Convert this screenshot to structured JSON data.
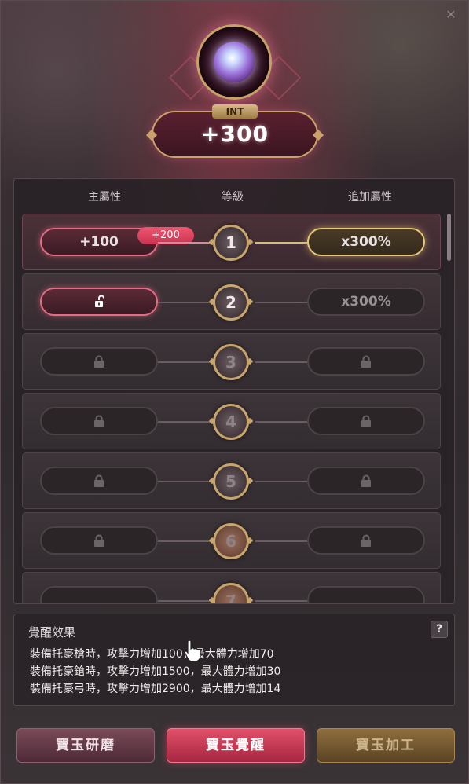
{
  "header": {
    "stat_tag": "INT",
    "stat_value": "+300"
  },
  "table": {
    "columns": [
      "主屬性",
      "等級",
      "追加屬性"
    ],
    "rows": [
      {
        "level": "1",
        "main": "+100",
        "bonus": "+200",
        "extra": "x300%",
        "state": "active"
      },
      {
        "level": "2",
        "main": "",
        "extra": "x300%",
        "state": "unlocked"
      },
      {
        "level": "3",
        "state": "locked"
      },
      {
        "level": "4",
        "state": "locked"
      },
      {
        "level": "5",
        "state": "locked"
      },
      {
        "level": "6",
        "state": "locked"
      },
      {
        "level": "7",
        "state": "locked"
      }
    ]
  },
  "effect": {
    "title": "覺醒效果",
    "help": "?",
    "lines": [
      "裝備托豪槍時，攻擊力增加100，最大體力增加70",
      "裝備托豪鎗時，攻擊力增加1500，最大體力增加30",
      "裝備托豪弓時，攻擊力增加2900，最大體力增加14"
    ]
  },
  "buttons": {
    "polish": "寶玉研磨",
    "awaken": "寶玉覺醒",
    "process": "寶玉加工"
  },
  "colors": {
    "accent_pink": "#e46d86",
    "accent_gold": "#e7c77a",
    "button_awaken": "#d23a56"
  }
}
